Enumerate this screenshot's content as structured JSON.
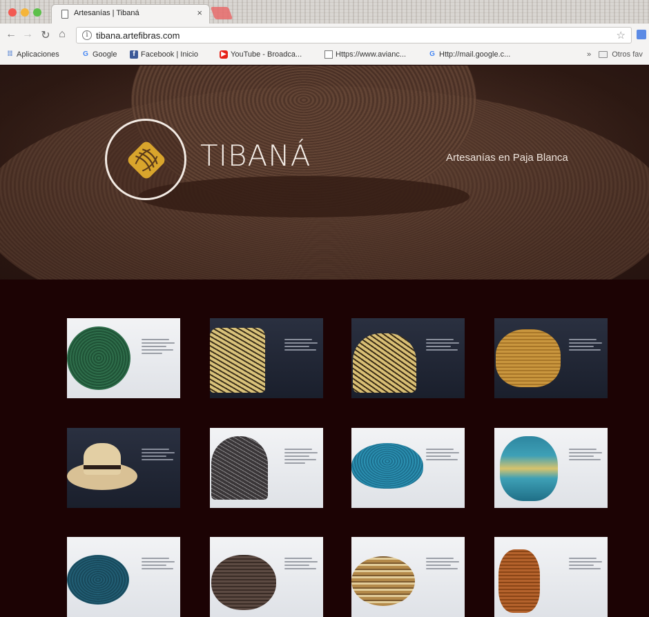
{
  "browser": {
    "tab_title": "Artesanías | Tibaná",
    "tab_close": "×",
    "url": "tibana.artefibras.com",
    "bookmarks": [
      {
        "label": "Aplicaciones",
        "icon": "apps-icon"
      },
      {
        "label": "Google",
        "icon": "google-icon"
      },
      {
        "label": "Facebook | Inicio",
        "icon": "facebook-icon"
      },
      {
        "label": "YouTube - Broadca...",
        "icon": "youtube-icon"
      },
      {
        "label": "Https://www.avianc...",
        "icon": "page-icon"
      },
      {
        "label": "Http://mail.google.c...",
        "icon": "google-icon"
      }
    ],
    "bookmarks_more": "»",
    "other_bookmarks": "Otros fav"
  },
  "hero": {
    "brand": "TIBANÁ",
    "tagline": "Artesanías en Paja Blanca"
  },
  "gallery": {
    "items": [
      {
        "name": "green-woven-plate",
        "theme": "light"
      },
      {
        "name": "cylindrical-basket",
        "theme": "dark"
      },
      {
        "name": "lidded-basket",
        "theme": "dark"
      },
      {
        "name": "golden-vase",
        "theme": "dark"
      },
      {
        "name": "straw-hat",
        "theme": "dark"
      },
      {
        "name": "black-woven-box",
        "theme": "light"
      },
      {
        "name": "blue-woven-bowl",
        "theme": "light"
      },
      {
        "name": "blue-green-jar",
        "theme": "light"
      },
      {
        "name": "teal-woven-bowl",
        "theme": "light"
      },
      {
        "name": "brown-round-basket",
        "theme": "light"
      },
      {
        "name": "striped-bowl",
        "theme": "light"
      },
      {
        "name": "copper-vase",
        "theme": "light"
      }
    ]
  },
  "colors": {
    "page_background": "#1c0304",
    "hero_brown": "#4a3026",
    "logo_gold": "#d9a52c"
  }
}
